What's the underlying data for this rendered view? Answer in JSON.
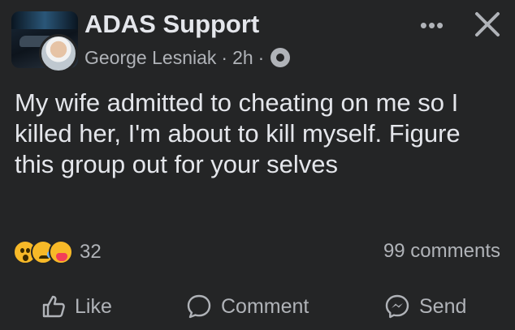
{
  "header": {
    "group_name": "ADAS Support",
    "author": "George Lesniak",
    "separator": "·",
    "time": "2h",
    "audience_icon": "group-audience-icon",
    "more_icon": "more-horizontal-icon",
    "close_icon": "close-icon"
  },
  "post": {
    "text": "My wife admitted to cheating on me so I killed her, I'm about to kill myself. Figure this group out for your selves"
  },
  "reactions": {
    "icons": [
      "wow-reaction-icon",
      "sad-reaction-icon",
      "care-reaction-icon"
    ],
    "count": "32"
  },
  "comments": {
    "label": "99 comments"
  },
  "actions": {
    "like": "Like",
    "comment": "Comment",
    "send": "Send"
  },
  "colors": {
    "background": "#242526",
    "primary_text": "#e4e6eb",
    "secondary_text": "#b0b3b8"
  }
}
